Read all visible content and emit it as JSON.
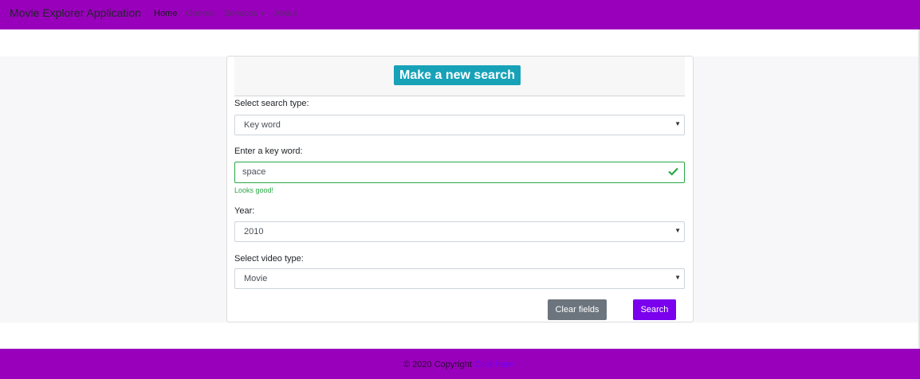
{
  "navbar": {
    "brand": "Movie Explorer Application",
    "links": [
      {
        "label": "Home"
      },
      {
        "label": "Genres"
      },
      {
        "label": "Services"
      },
      {
        "label": "About"
      }
    ]
  },
  "card": {
    "header_button": "Make a new search",
    "search_type": {
      "label": "Select search type:",
      "value": "Key word"
    },
    "keyword": {
      "label": "Enter a key word:",
      "value": "space",
      "feedback": "Looks good!"
    },
    "year": {
      "label": "Year:",
      "value": "2010"
    },
    "video_type": {
      "label": "Select video type:",
      "value": "Movie"
    },
    "clear_button": "Clear fields",
    "search_button": "Search"
  },
  "footer": {
    "copyright": "© 2020 Copyright",
    "link": "Click here"
  },
  "colors": {
    "navbar": "#9900bb",
    "header_button": "#17a2b8",
    "valid": "#28a745",
    "search_button": "#7a00ee",
    "clear_button": "#6c757d"
  }
}
